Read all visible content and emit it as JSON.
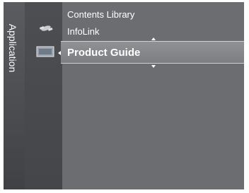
{
  "sidebar": {
    "label": "Application"
  },
  "menu": {
    "items": [
      {
        "label": "Contents Library"
      },
      {
        "label": "InfoLink"
      },
      {
        "label": "Product Guide"
      }
    ]
  },
  "icons": {
    "row1": "satellite-dish-icon",
    "row2": "tv-screen-icon"
  }
}
